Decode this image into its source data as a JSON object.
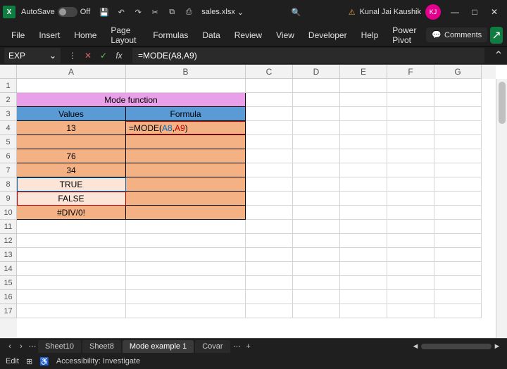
{
  "titlebar": {
    "app_letter": "X",
    "autosave_label": "AutoSave",
    "autosave_state": "Off",
    "filename": "sales.xlsx",
    "user_name": "Kunal Jai Kaushik",
    "user_initials": "KJ"
  },
  "ribbon": {
    "tabs": [
      "File",
      "Insert",
      "Home",
      "Page Layout",
      "Formulas",
      "Data",
      "Review",
      "View",
      "Developer",
      "Help",
      "Power Pivot"
    ],
    "comments": "Comments"
  },
  "formula_bar": {
    "namebox": "EXP",
    "formula_prefix": "=MODE(",
    "arg1": "A8",
    "comma": ",",
    "arg2": "A9",
    "formula_suffix": ")"
  },
  "grid": {
    "columns": [
      "A",
      "B",
      "C",
      "D",
      "E",
      "F",
      "G"
    ],
    "row_count": 17,
    "merged_title": "Mode function",
    "header_a": "Values",
    "header_b": "Formula",
    "a4": "13",
    "b4_prefix": "=MODE(",
    "b4_arg1": "A8",
    "b4_comma": ",",
    "b4_arg2": "A9",
    "b4_suffix": ")",
    "a6": "76",
    "a7": "34",
    "a8": "TRUE",
    "a9": "FALSE",
    "a10": "#DIV/0!"
  },
  "sheet_tabs": {
    "tabs": [
      "Sheet10",
      "Sheet8",
      "Mode example 1",
      "Covar"
    ],
    "active_index": 2
  },
  "status": {
    "mode": "Edit",
    "accessibility": "Accessibility: Investigate"
  }
}
